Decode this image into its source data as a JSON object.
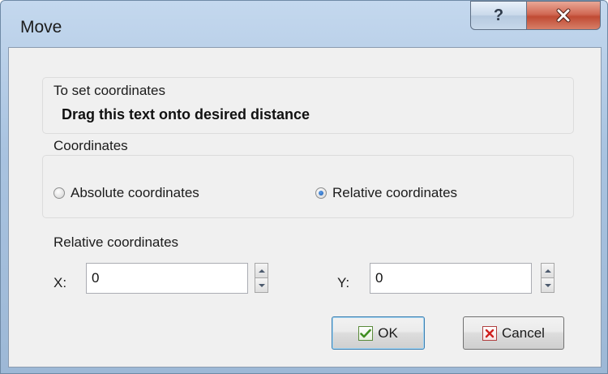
{
  "window": {
    "title": "Move"
  },
  "title_buttons": {
    "help_label": "?",
    "close_icon": "close-icon"
  },
  "group_set_coords": {
    "label": "To set coordinates",
    "drag_text": "Drag this text onto desired distance"
  },
  "group_coordinates": {
    "label": "Coordinates",
    "options": [
      {
        "label": "Absolute coordinates",
        "checked": false
      },
      {
        "label": "Relative coordinates",
        "checked": true
      }
    ]
  },
  "relative": {
    "label": "Relative coordinates",
    "x_label": "X:",
    "x_value": "0",
    "y_label": "Y:",
    "y_value": "0"
  },
  "buttons": {
    "ok_label": "OK",
    "cancel_label": "Cancel"
  },
  "colors": {
    "check_green": "#3f8f1f",
    "cancel_red": "#d0201f",
    "radio_selected": "#1f5fb1"
  }
}
